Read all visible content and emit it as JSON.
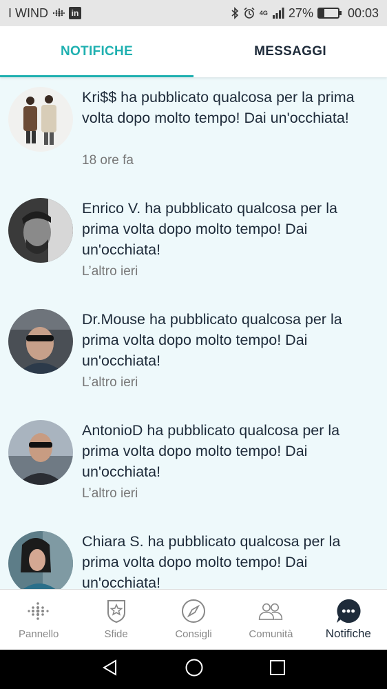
{
  "status_bar": {
    "carrier": "I WIND",
    "linkedin_label": "in",
    "network": "4G",
    "battery": "27%",
    "battery_level": 0.27,
    "time": "00:03"
  },
  "tabs": [
    {
      "label": "NOTIFICHE",
      "active": true
    },
    {
      "label": "MESSAGGI",
      "active": false
    }
  ],
  "notifications": [
    {
      "text": "Kri$$ ha pubblicato qualcosa per la prima volta dopo molto tempo! Dai un'occhiata!",
      "time": "18 ore fa"
    },
    {
      "text": "Enrico V. ha pubblicato qualcosa per la prima volta dopo molto tempo! Dai un'occhiata!",
      "time": "L’altro ieri"
    },
    {
      "text": "Dr.Mouse ha pubblicato qualcosa per la prima volta dopo molto tempo! Dai un'occhiata!",
      "time": "L’altro ieri"
    },
    {
      "text": "AntonioD ha pubblicato qualcosa per la prima volta dopo molto tempo! Dai un'occhiata!",
      "time": "L’altro ieri"
    },
    {
      "text": "Chiara S. ha pubblicato qualcosa per la prima volta dopo molto tempo! Dai un'occhiata!",
      "time": ""
    }
  ],
  "bottom_nav": [
    {
      "label": "Pannello",
      "icon": "dashboard-dots-icon"
    },
    {
      "label": "Sfide",
      "icon": "challenge-shield-icon"
    },
    {
      "label": "Consigli",
      "icon": "compass-icon"
    },
    {
      "label": "Comunità",
      "icon": "community-icon"
    },
    {
      "label": "Notifiche",
      "icon": "notifications-bubble-icon",
      "active": true
    }
  ],
  "colors": {
    "accent": "#1fb0b0",
    "feed_background": "#eef9fb",
    "text": "#1e2b3a"
  }
}
